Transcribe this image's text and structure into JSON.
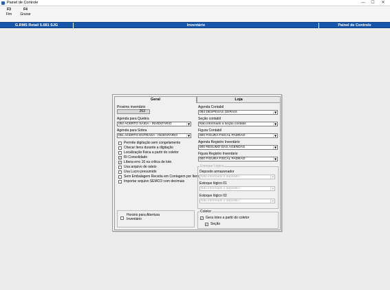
{
  "window": {
    "title": "Painel de Controle",
    "minimize": "—",
    "maximize": "☐",
    "close": "✕"
  },
  "toolbar": {
    "items": [
      {
        "key": "F3",
        "label": "Fim"
      },
      {
        "key": "F4",
        "label": "Gravar"
      }
    ]
  },
  "header": {
    "left": "G.RMS Retail 5.681 SJG",
    "center": "Inventário",
    "right": "Painel de Controle"
  },
  "tabs": [
    {
      "label": "Geral"
    },
    {
      "label": "Loja"
    }
  ],
  "left": {
    "proximo_label": "Proximo inventário",
    "proximo_value": "263",
    "quebra_label": "Agenda para Quebra",
    "quebra_value": "052 ACERTO SAIDA - INVENTARIO",
    "sobra_label": "Agenda para Sobra",
    "sobra_value": "051 ACERTO ENTRADA - INVENTARIO",
    "checks": [
      {
        "label": "Permite digitação sem congelamento",
        "checked": false
      },
      {
        "label": "Checar itens durante a digitação",
        "checked": false
      },
      {
        "label": "Localização física a partir do coletor",
        "checked": false
      },
      {
        "label": "RI Consolidado",
        "checked": true
      },
      {
        "label": "Libera erro 16 na crítica de lote.",
        "checked": true
      },
      {
        "label": "Usa arquivo de rateio",
        "checked": false
      },
      {
        "label": "Usa Lucro presumido",
        "checked": false
      },
      {
        "label": "Sem Embalagem  Receita em Contagem por Item",
        "checked": false
      },
      {
        "label": "Importar arquivo SEMCO com decimais",
        "checked": false
      }
    ],
    "horario_line1": "Horário para Abertura",
    "horario_line2": "Inventário"
  },
  "right": {
    "agenda_contabil_label": "Agenda Contabil",
    "agenda_contabil_value": "094 DESPESAS GERAIS",
    "secao_contabil_label": "Seção contabil",
    "secao_contabil_value": "Não informado a seção contabil",
    "figura_contabil_label": "Figura Contabil",
    "figura_contabil_value": "000 FIGURA FISCAL PADRAO",
    "agenda_registro_label": "Agenda Registro Inventário",
    "agenda_registro_value": "000 RESUMO DAS AGENDAS",
    "figura_registro_label": "Figura Registro Inventário",
    "figura_registro_value": "000 FIGURA FISCAL PADRAO",
    "estoque_group": "Estoque Lógico",
    "deposito_label": "Deposito armazenador",
    "deposito_value": "Não informado o deposito !",
    "estoque01_label": "Estoque lógico 01",
    "estoque01_value": "Não informado o deposito !",
    "estoque02_label": "Estoque lógico 02",
    "estoque02_value": "Não informado o deposito !",
    "coletor_group": "Coletor",
    "gera_lotes_label": "Gera lotes a partir do coletor",
    "secao_label": "Seção"
  },
  "colors": {
    "header_bar": "#1656ab",
    "dialog_bg": "#f0f0f0"
  }
}
